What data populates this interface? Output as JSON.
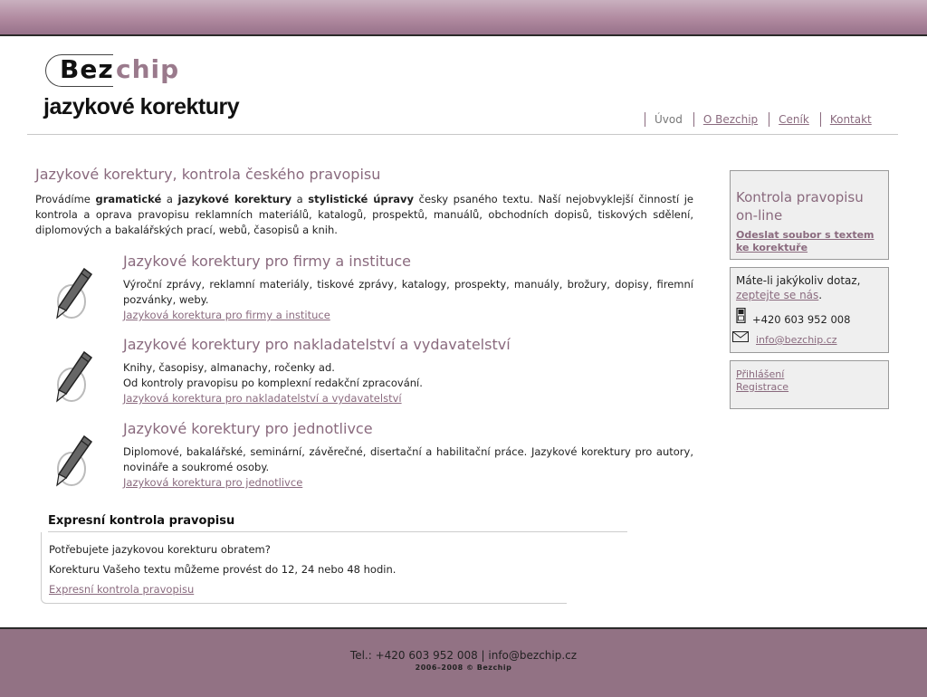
{
  "logo": {
    "part1": "Bez",
    "part2": "chip",
    "subtitle": "jazykové korektury"
  },
  "nav": {
    "items": [
      "Úvod",
      "O Bezchip",
      "Ceník",
      "Kontakt"
    ]
  },
  "main": {
    "title": "Jazykové korektury, kontrola českého pravopisu",
    "intro": {
      "t1": "Provádíme ",
      "b1": "gramatické",
      "t2": " a ",
      "b2": "jazykové korektury",
      "t3": " a ",
      "b3": "stylistické úpravy",
      "t4": " česky psaného textu. Naší nejobvyklejší činností je kontrola a oprava pravopisu reklamních materiálů, katalogů, prospektů, manuálů, obchodních dopisů, tiskových sdělení, diplomových a bakalářských prací, webů, časopisů a knih."
    },
    "services": [
      {
        "icon": "pen-icon",
        "title": "Jazykové korektury pro firmy a instituce",
        "lines": [
          "Výroční zprávy, reklamní materiály, tiskové zprávy, katalogy, prospekty, manuály, brožury, dopisy, firemní pozvánky, weby."
        ],
        "link": "Jazyková korektura pro firmy a instituce"
      },
      {
        "icon": "pen-icon",
        "title": "Jazykové korektury pro nakladatelství a vydavatelství",
        "lines": [
          "Knihy, časopisy, almanachy, ročenky ad.",
          "Od kontroly pravopisu po komplexní redakční zpracování."
        ],
        "link": "Jazyková korektura pro nakladatelství a vydavatelství"
      },
      {
        "icon": "pen-icon",
        "title": "Jazykové korektury pro jednotlivce",
        "lines": [
          "Diplomové, bakalářské, seminární, závěrečné, disertační a habilitační práce. Jazykové korektury pro autory, novináře a soukromé osoby."
        ],
        "link": "Jazyková korektura pro jednotlivce"
      }
    ]
  },
  "express": {
    "title": "Expresní kontrola pravopisu",
    "line1": "Potřebujete jazykovou korekturu obratem?",
    "line2": "Korekturu Vašeho textu můžeme provést do 12, 24 nebo 48 hodin.",
    "link": "Expresní kontrola pravopisu"
  },
  "sidebar": {
    "online_title": "Kontrola pravopisu on-line",
    "online_link": "Odeslat soubor s textem ke korektuře",
    "contact_text": "Máte-li jakýkoliv dotaz,",
    "contact_link": "zeptejte se nás",
    "contact_dot": ".",
    "phone": "+420 603 952 008",
    "email": "info@bezchip.cz",
    "login": "Přihlášení",
    "register": "Registrace"
  },
  "footer": {
    "line1": "Tel.: +420 603 952 008 | info@bezchip.cz",
    "line2": "2006–2008 © Bezchip"
  },
  "colors": {
    "accent": "#8a6a7e",
    "footer_bg": "#927284",
    "sidebar_bg": "#efefef"
  }
}
